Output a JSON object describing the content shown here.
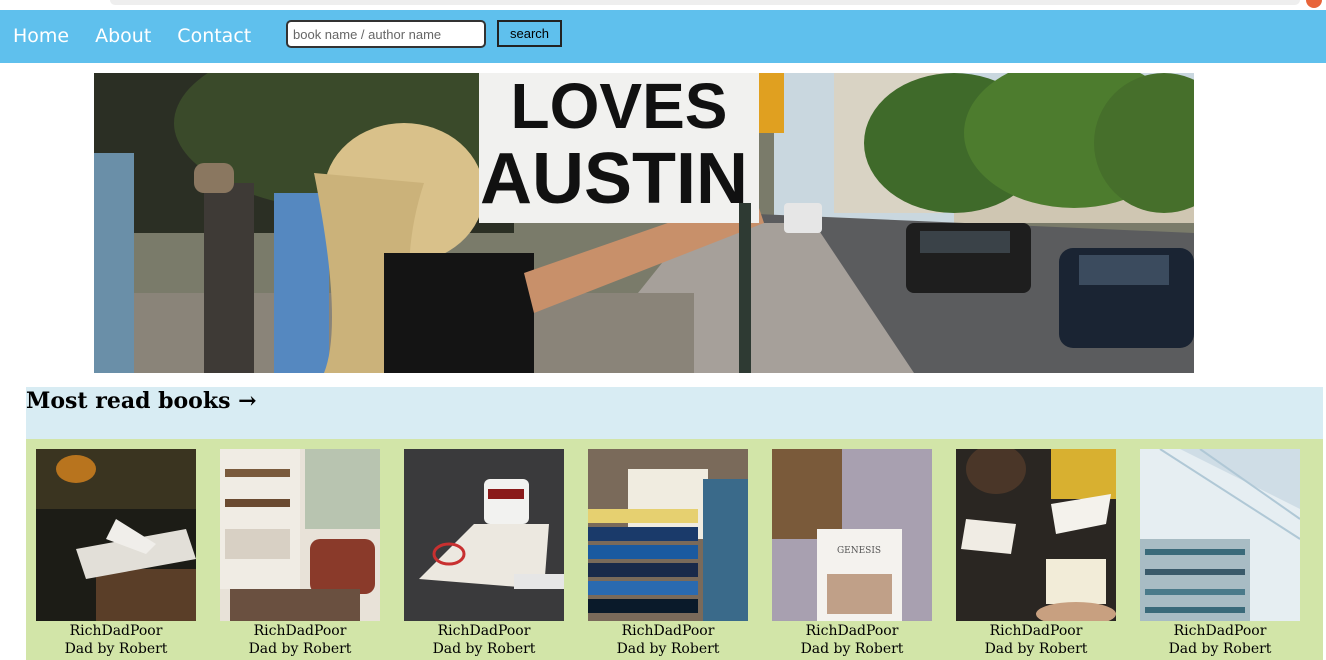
{
  "nav": {
    "links": [
      "Home",
      "About",
      "Contact"
    ]
  },
  "search": {
    "placeholder": "book name / author name",
    "button_label": "search"
  },
  "hero": {
    "sign_line1": "LOVES",
    "sign_line2": "AUSTIN"
  },
  "section": {
    "title": "Most read books →"
  },
  "books": [
    {
      "title_line1": "RichDadPoor",
      "title_line2": "Dad by Robert"
    },
    {
      "title_line1": "RichDadPoor",
      "title_line2": "Dad by Robert"
    },
    {
      "title_line1": "RichDadPoor",
      "title_line2": "Dad by Robert"
    },
    {
      "title_line1": "RichDadPoor",
      "title_line2": "Dad by Robert"
    },
    {
      "title_line1": "RichDadPoor",
      "title_line2": "Dad by Robert"
    },
    {
      "title_line1": "RichDadPoor",
      "title_line2": "Dad by Robert"
    },
    {
      "title_line1": "RichDadPoor",
      "title_line2": "Dad by Robert"
    }
  ],
  "book_labels": {
    "cover5_title": "GENESIS"
  }
}
